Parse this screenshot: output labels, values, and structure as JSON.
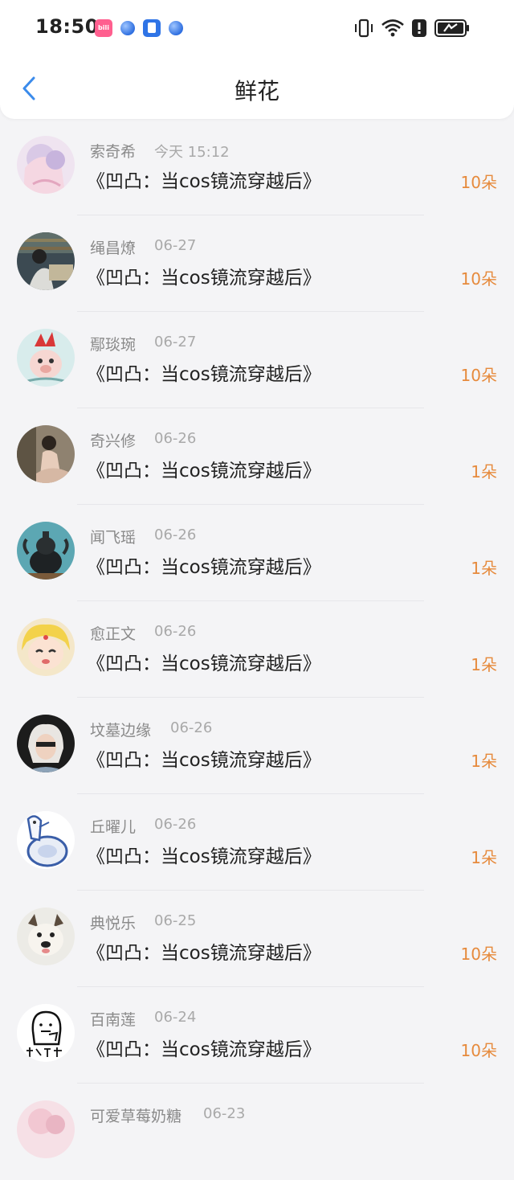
{
  "status_bar": {
    "time": "18:50",
    "notification_icons": [
      "bilibili-app-icon",
      "blue-orb-app-icon",
      "vpn-key-icon",
      "blue-orb-app-icon"
    ],
    "system_icons": [
      "vibrate-icon",
      "wifi-icon",
      "alert-icon",
      "battery-charging-icon"
    ]
  },
  "header": {
    "title": "鲜花",
    "back_icon": "chevron-left-icon"
  },
  "colors": {
    "accent_blue": "#3b8beb",
    "count_orange": "#e68a3c",
    "name_gray": "#8a8a8a",
    "date_gray": "#a9a9a9",
    "background": "#f4f4f6"
  },
  "items": [
    {
      "name": "索奇希",
      "date": "今天 15:12",
      "title": "《凹凸：当cos镜流穿越后》",
      "count": "10朵"
    },
    {
      "name": "绳昌燎",
      "date": "06-27",
      "title": "《凹凸：当cos镜流穿越后》",
      "count": "10朵"
    },
    {
      "name": "鄢琰琬",
      "date": "06-27",
      "title": "《凹凸：当cos镜流穿越后》",
      "count": "10朵"
    },
    {
      "name": "奇兴修",
      "date": "06-26",
      "title": "《凹凸：当cos镜流穿越后》",
      "count": "1朵"
    },
    {
      "name": "闻飞瑶",
      "date": "06-26",
      "title": "《凹凸：当cos镜流穿越后》",
      "count": "1朵"
    },
    {
      "name": "愈正文",
      "date": "06-26",
      "title": "《凹凸：当cos镜流穿越后》",
      "count": "1朵"
    },
    {
      "name": "坟墓边缘",
      "date": "06-26",
      "title": "《凹凸：当cos镜流穿越后》",
      "count": "1朵"
    },
    {
      "name": "丘曜儿",
      "date": "06-26",
      "title": "《凹凸：当cos镜流穿越后》",
      "count": "1朵"
    },
    {
      "name": "典悦乐",
      "date": "06-25",
      "title": "《凹凸：当cos镜流穿越后》",
      "count": "10朵"
    },
    {
      "name": "百南莲",
      "date": "06-24",
      "title": "《凹凸：当cos镜流穿越后》",
      "count": "10朵"
    },
    {
      "name": "可爱草莓奶糖",
      "date": "06-23",
      "title": "",
      "count": ""
    }
  ]
}
